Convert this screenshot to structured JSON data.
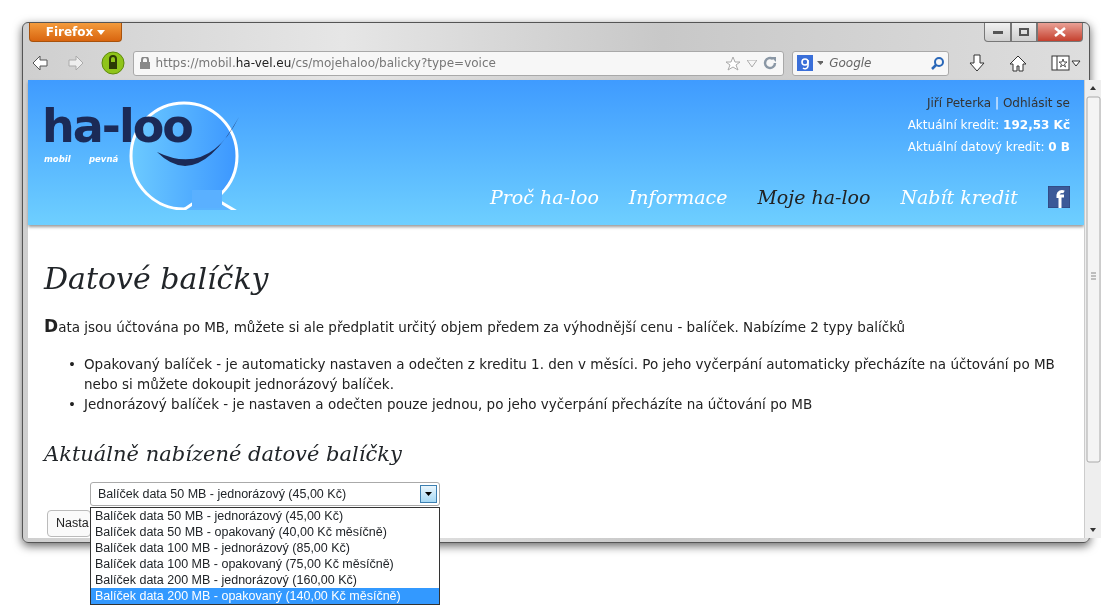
{
  "window": {
    "app_button": "Firefox"
  },
  "toolbar": {
    "url": {
      "prefix": "https://mobil.",
      "domain": "ha-vel.eu",
      "path": "/cs/mojehaloo/balicky?type=voice"
    },
    "search": {
      "placeholder": "Google"
    }
  },
  "header": {
    "logo": {
      "name": "ha-loo",
      "tagline_left": "mobil",
      "tagline_right": "pevná"
    },
    "user": {
      "name": "Jiří Peterka",
      "separator": "|",
      "logout": "Odhlásit se"
    },
    "credits": [
      "Aktuální kredit: **192,53 Kč**",
      "Aktuální datový kredit: **0 B**"
    ],
    "nav": [
      {
        "label": "Proč ha-loo",
        "selected": false
      },
      {
        "label": "Informace",
        "selected": false
      },
      {
        "label": "Moje ha-loo",
        "selected": true
      },
      {
        "label": "Nabít kredit",
        "selected": false
      }
    ]
  },
  "content": {
    "title": "Datové balíčky",
    "intro": "**D**ata jsou účtována po MB, můžete si ale předplatit určitý objem předem za výhodnější cenu - balíček. Nabízíme 2 typy balíčků",
    "bullets": [
      "Opakovaný balíček - je automaticky nastaven a odečten z kreditu 1. den v měsíci. Po jeho vyčerpání automaticky přecházíte na účtování po MB nebo si můžete dokoupit jednorázový balíček.",
      "Jednorázový balíček - je nastaven a odečten pouze jednou, po jeho vyčerpání přecházíte na účtování po MB"
    ],
    "bullet_marker": "•",
    "subtitle": "Aktuálně nabízené datové balíčky",
    "select": {
      "value": "Balíček data 50 MB - jednorázový (45,00 Kč)",
      "options": [
        {
          "label": "Balíček data 50 MB - jednorázový (45,00 Kč)",
          "highlighted": false
        },
        {
          "label": "Balíček data 50 MB - opakovaný (40,00 Kč měsíčně)",
          "highlighted": false
        },
        {
          "label": "Balíček data 100 MB - jednorázový (85,00 Kč)",
          "highlighted": false
        },
        {
          "label": "Balíček data 100 MB - opakovaný (75,00 Kč měsíčně)",
          "highlighted": false
        },
        {
          "label": "Balíček data 200 MB - jednorázový (160,00 Kč)",
          "highlighted": false
        },
        {
          "label": "Balíček data 200 MB - opakovaný (140,00 Kč měsíčně)",
          "highlighted": true
        }
      ]
    },
    "button": "Nasta"
  }
}
